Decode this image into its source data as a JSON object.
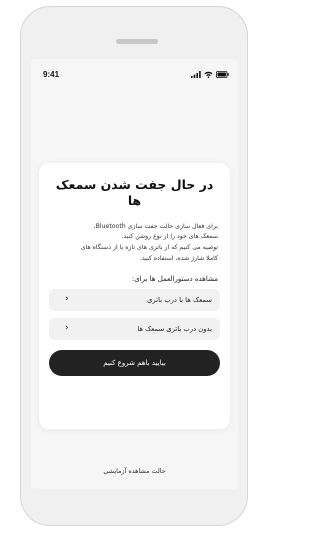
{
  "status_bar": {
    "time": "9:41",
    "icons": [
      "cellular-signal-icon",
      "wifi-icon",
      "battery-icon"
    ]
  },
  "card": {
    "title": "در حال جفت شدن سمعک ها",
    "body_lines": [
      "برای فعال سازی حالت جفت سازی Bluetooth،",
      "سمعک های خود را از نوع روشن کنید.",
      "توصیه می کنیم که از باتری های تازه یا از دستگاه های",
      "کاملا شارژ شده، استفاده کنید."
    ],
    "instructions_heading": "مشاهده دستورالعمل ها برای:",
    "options": [
      {
        "label": "سمعک ها با درب باتری",
        "icon": "chevron-left-icon"
      },
      {
        "label": "بدون درب باتری سمعک ها",
        "icon": "chevron-left-icon"
      }
    ],
    "cta_label": "بیایید باهم شروع کنیم"
  },
  "demo_link": "حالت مشاهده آزمایشی",
  "colors": {
    "device_frame": "#f0f0f0",
    "screen_bg": "#f6f6f6",
    "card_bg": "#ffffff",
    "option_bg": "#f1f1f1",
    "cta_bg": "#222222",
    "cta_text": "#ffffff"
  }
}
